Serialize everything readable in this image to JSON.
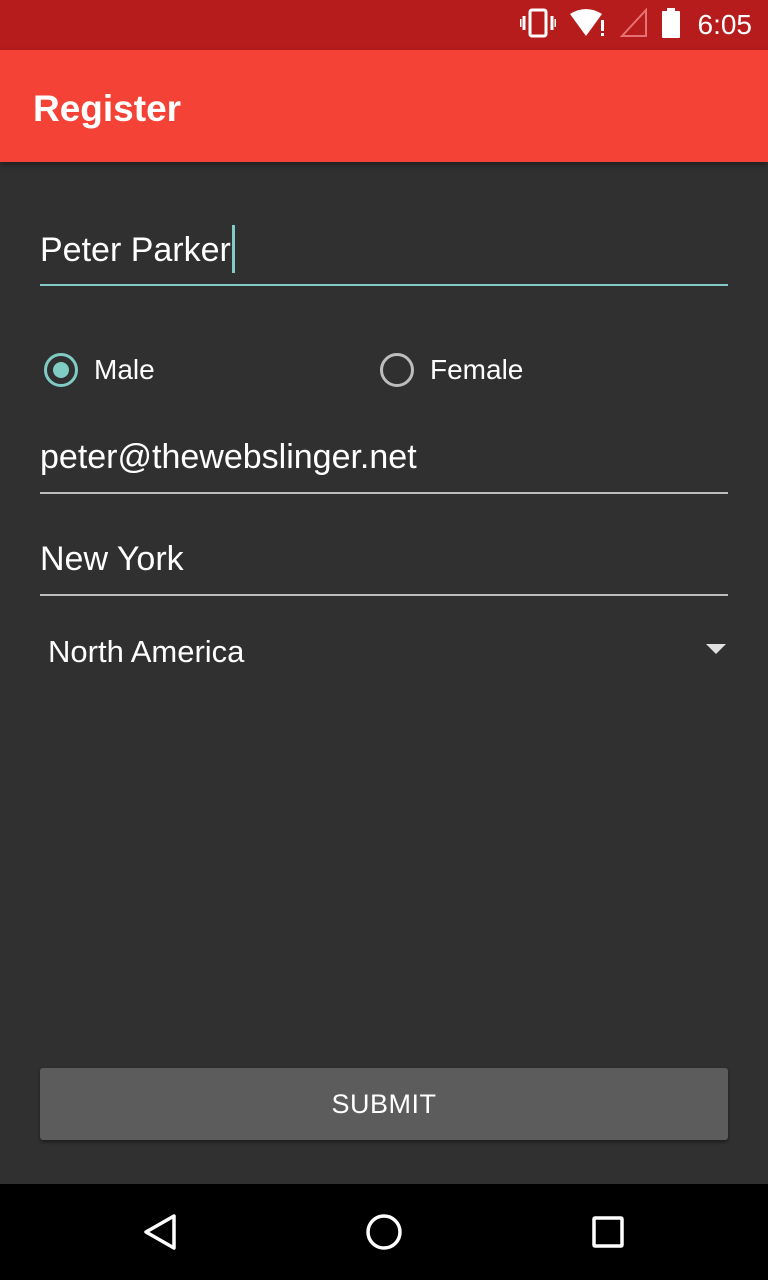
{
  "status_bar": {
    "time": "6:05",
    "icons": [
      "vibrate-icon",
      "wifi-alert-icon",
      "signal-icon",
      "battery-icon"
    ],
    "color": "#b71c1c"
  },
  "app_bar": {
    "title": "Register",
    "color": "#f44336"
  },
  "form": {
    "name_value": "Peter Parker",
    "gender": {
      "options": [
        {
          "label": "Male",
          "checked": true
        },
        {
          "label": "Female",
          "checked": false
        }
      ]
    },
    "email_value": "peter@thewebslinger.net",
    "city_value": "New York",
    "region_selected": "North America",
    "submit_label": "SUBMIT"
  },
  "accent_color": "#80cbc4",
  "nav_bar": {
    "buttons": [
      "back-icon",
      "home-icon",
      "recents-icon"
    ]
  }
}
